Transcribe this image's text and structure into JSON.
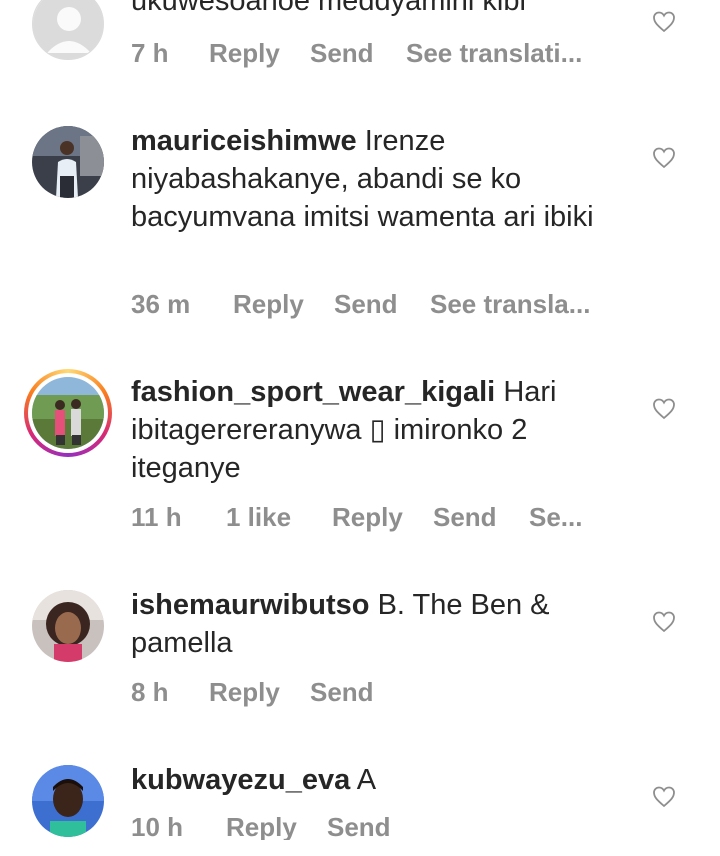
{
  "comments": [
    {
      "username": "",
      "text": "ukuwesoanoe meddyamini kibi",
      "time": "7 h",
      "likes": "",
      "reply": "Reply",
      "send": "Send",
      "translate": "See translati..."
    },
    {
      "username": "mauriceishimwe",
      "text": "Irenze niyabashakanye, abandi se ko bacyumvana imitsi wamenta ari ibiki",
      "time": "36 m",
      "likes": "",
      "reply": "Reply",
      "send": "Send",
      "translate": "See transla..."
    },
    {
      "username": "fashion_sport_wear_kigali",
      "text": "Hari ibitagerereranywa ▯ imironko 2 iteganye",
      "time": "11 h",
      "likes": "1 like",
      "reply": "Reply",
      "send": "Send",
      "translate": "Se..."
    },
    {
      "username": "ishemaurwibutso",
      "text": "B. The Ben & pamella",
      "time": "8 h",
      "likes": "",
      "reply": "Reply",
      "send": "Send",
      "translate": ""
    },
    {
      "username": "kubwayezu_eva",
      "text": "A",
      "time": "10 h",
      "likes": "",
      "reply": "Reply",
      "send": "Send",
      "translate": ""
    }
  ],
  "icons": {
    "like": "heart-outline-icon",
    "default_avatar": "default-avatar-icon"
  },
  "colors": {
    "text": "#262626",
    "meta": "#8e8e8e",
    "story_ring": "#d62976"
  }
}
